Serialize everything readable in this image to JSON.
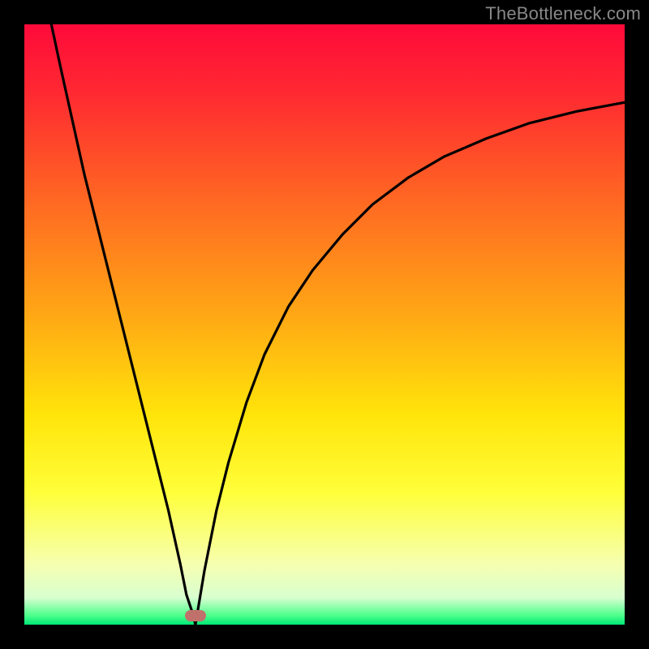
{
  "watermark": "TheBottleneck.com",
  "colors": {
    "frame": "#000000",
    "gradient_stops": [
      {
        "offset": 0.0,
        "color": "#ff0a3a"
      },
      {
        "offset": 0.12,
        "color": "#ff2b31"
      },
      {
        "offset": 0.3,
        "color": "#ff6a22"
      },
      {
        "offset": 0.48,
        "color": "#ffa615"
      },
      {
        "offset": 0.65,
        "color": "#ffe40a"
      },
      {
        "offset": 0.78,
        "color": "#ffff3a"
      },
      {
        "offset": 0.9,
        "color": "#f6ffb0"
      },
      {
        "offset": 0.955,
        "color": "#d8ffd0"
      },
      {
        "offset": 0.985,
        "color": "#4bff8a"
      },
      {
        "offset": 1.0,
        "color": "#00e676"
      }
    ],
    "curve": "#000000",
    "marker": "#c1716b"
  },
  "marker": {
    "x_frac": 0.285,
    "y_frac": 0.985
  },
  "chart_data": {
    "type": "line",
    "title": "",
    "xlabel": "",
    "ylabel": "",
    "xlim": [
      0,
      100
    ],
    "ylim": [
      0,
      100
    ],
    "grid": false,
    "series": [
      {
        "name": "left-branch",
        "x": [
          4.5,
          6,
          8,
          10,
          12,
          14,
          16,
          18,
          20,
          22,
          24,
          26,
          27,
          28,
          28.5
        ],
        "y": [
          100,
          93,
          84,
          75,
          67,
          59,
          51,
          43,
          35,
          27,
          19,
          10,
          5,
          2,
          0
        ]
      },
      {
        "name": "right-branch",
        "x": [
          28.5,
          29,
          30,
          32,
          34,
          37,
          40,
          44,
          48,
          53,
          58,
          64,
          70,
          77,
          84,
          92,
          100
        ],
        "y": [
          0,
          3,
          9,
          19,
          27,
          37,
          45,
          53,
          59,
          65,
          70,
          74.5,
          78,
          81,
          83.5,
          85.5,
          87
        ]
      }
    ],
    "annotations": [
      {
        "type": "pill-marker",
        "x": 28.5,
        "y": 1
      }
    ]
  }
}
